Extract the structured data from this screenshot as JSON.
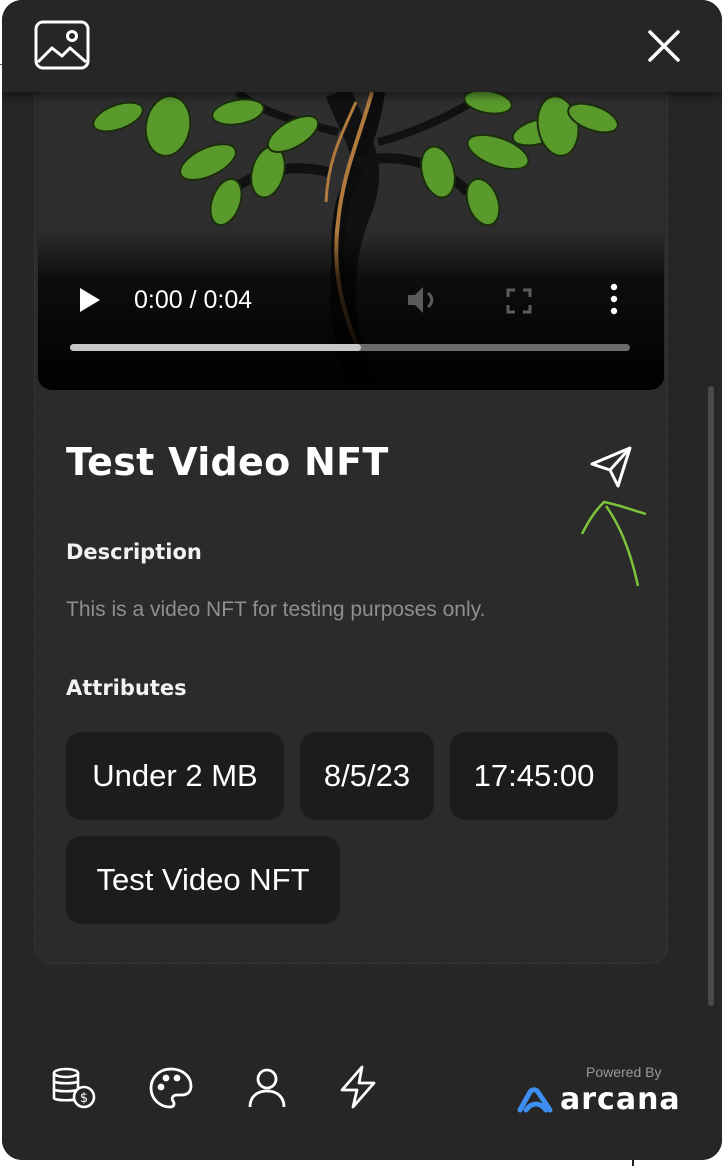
{
  "topbar": {
    "image_icon": "image-icon",
    "close_icon": "close-icon"
  },
  "video": {
    "time": "0:00 / 0:04",
    "progress": 0.52,
    "icons": [
      "play-icon",
      "volume-icon",
      "fullscreen-icon",
      "more-vert-icon"
    ]
  },
  "nft": {
    "title": "Test Video NFT",
    "send_icon": "send-icon",
    "description_label": "Description",
    "description": "This is a video NFT for testing purposes only.",
    "attributes_label": "Attributes",
    "attributes": [
      "Under 2 MB",
      "8/5/23",
      "17:45:00",
      "Test Video NFT"
    ]
  },
  "bottom_nav": {
    "items": [
      "coins-icon",
      "palette-icon",
      "user-icon",
      "bolt-icon"
    ],
    "powered_by": "Powered By",
    "brand": "arcana"
  },
  "colors": {
    "background": "#262626",
    "card": "#2b2b2b",
    "chip": "#1c1c1c",
    "accent": "#3d8ef0",
    "annotation": "#7cc23a"
  }
}
